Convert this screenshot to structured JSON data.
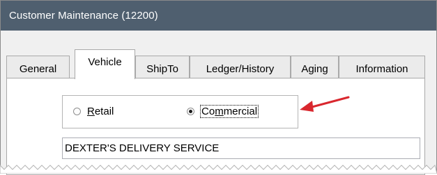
{
  "window": {
    "title": "Customer Maintenance (12200)"
  },
  "tabs": [
    {
      "label": "General",
      "active": false
    },
    {
      "label": "Vehicle",
      "active": true
    },
    {
      "label": "ShipTo",
      "active": false
    },
    {
      "label": "Ledger/History",
      "active": false
    },
    {
      "label": "Aging",
      "active": false
    },
    {
      "label": "Information",
      "active": false
    }
  ],
  "customer_type": {
    "options": [
      {
        "prefix": "",
        "accel": "R",
        "suffix": "etail",
        "selected": false
      },
      {
        "prefix": "Co",
        "accel": "m",
        "suffix": "mercial",
        "selected": true
      }
    ]
  },
  "customer_name": {
    "value": "DEXTER'S DELIVERY SERVICE"
  },
  "colors": {
    "titlebar": "#4f5f6f",
    "annotation_arrow": "#d9272e",
    "window_bg": "#f0f0f0"
  }
}
